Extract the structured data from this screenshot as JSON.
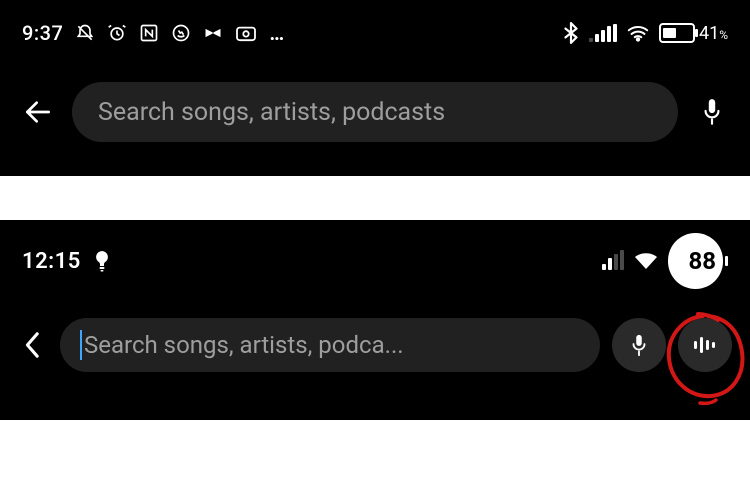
{
  "panel1": {
    "status": {
      "time": "9:37",
      "more": "…",
      "battery_percent": "41",
      "battery_fill_pct": 41,
      "icons_left": [
        "mute",
        "alarm",
        "nfc",
        "whatsapp",
        "capcut",
        "camera"
      ],
      "icons_right": [
        "bluetooth",
        "signal",
        "wifi",
        "battery"
      ]
    },
    "search": {
      "placeholder": "Search songs, artists, podcasts",
      "back": "back",
      "mic": "voice-search"
    }
  },
  "panel2": {
    "status": {
      "time": "12:15",
      "battery_percent": "88",
      "icons_left": [
        "bulb"
      ],
      "icons_right": [
        "signal",
        "wifi",
        "battery"
      ]
    },
    "search": {
      "placeholder": "Search songs, artists, podca...",
      "back": "back",
      "mic": "voice-search",
      "sound": "sound-search"
    },
    "annotation": "red-circle-around-sound-search"
  }
}
